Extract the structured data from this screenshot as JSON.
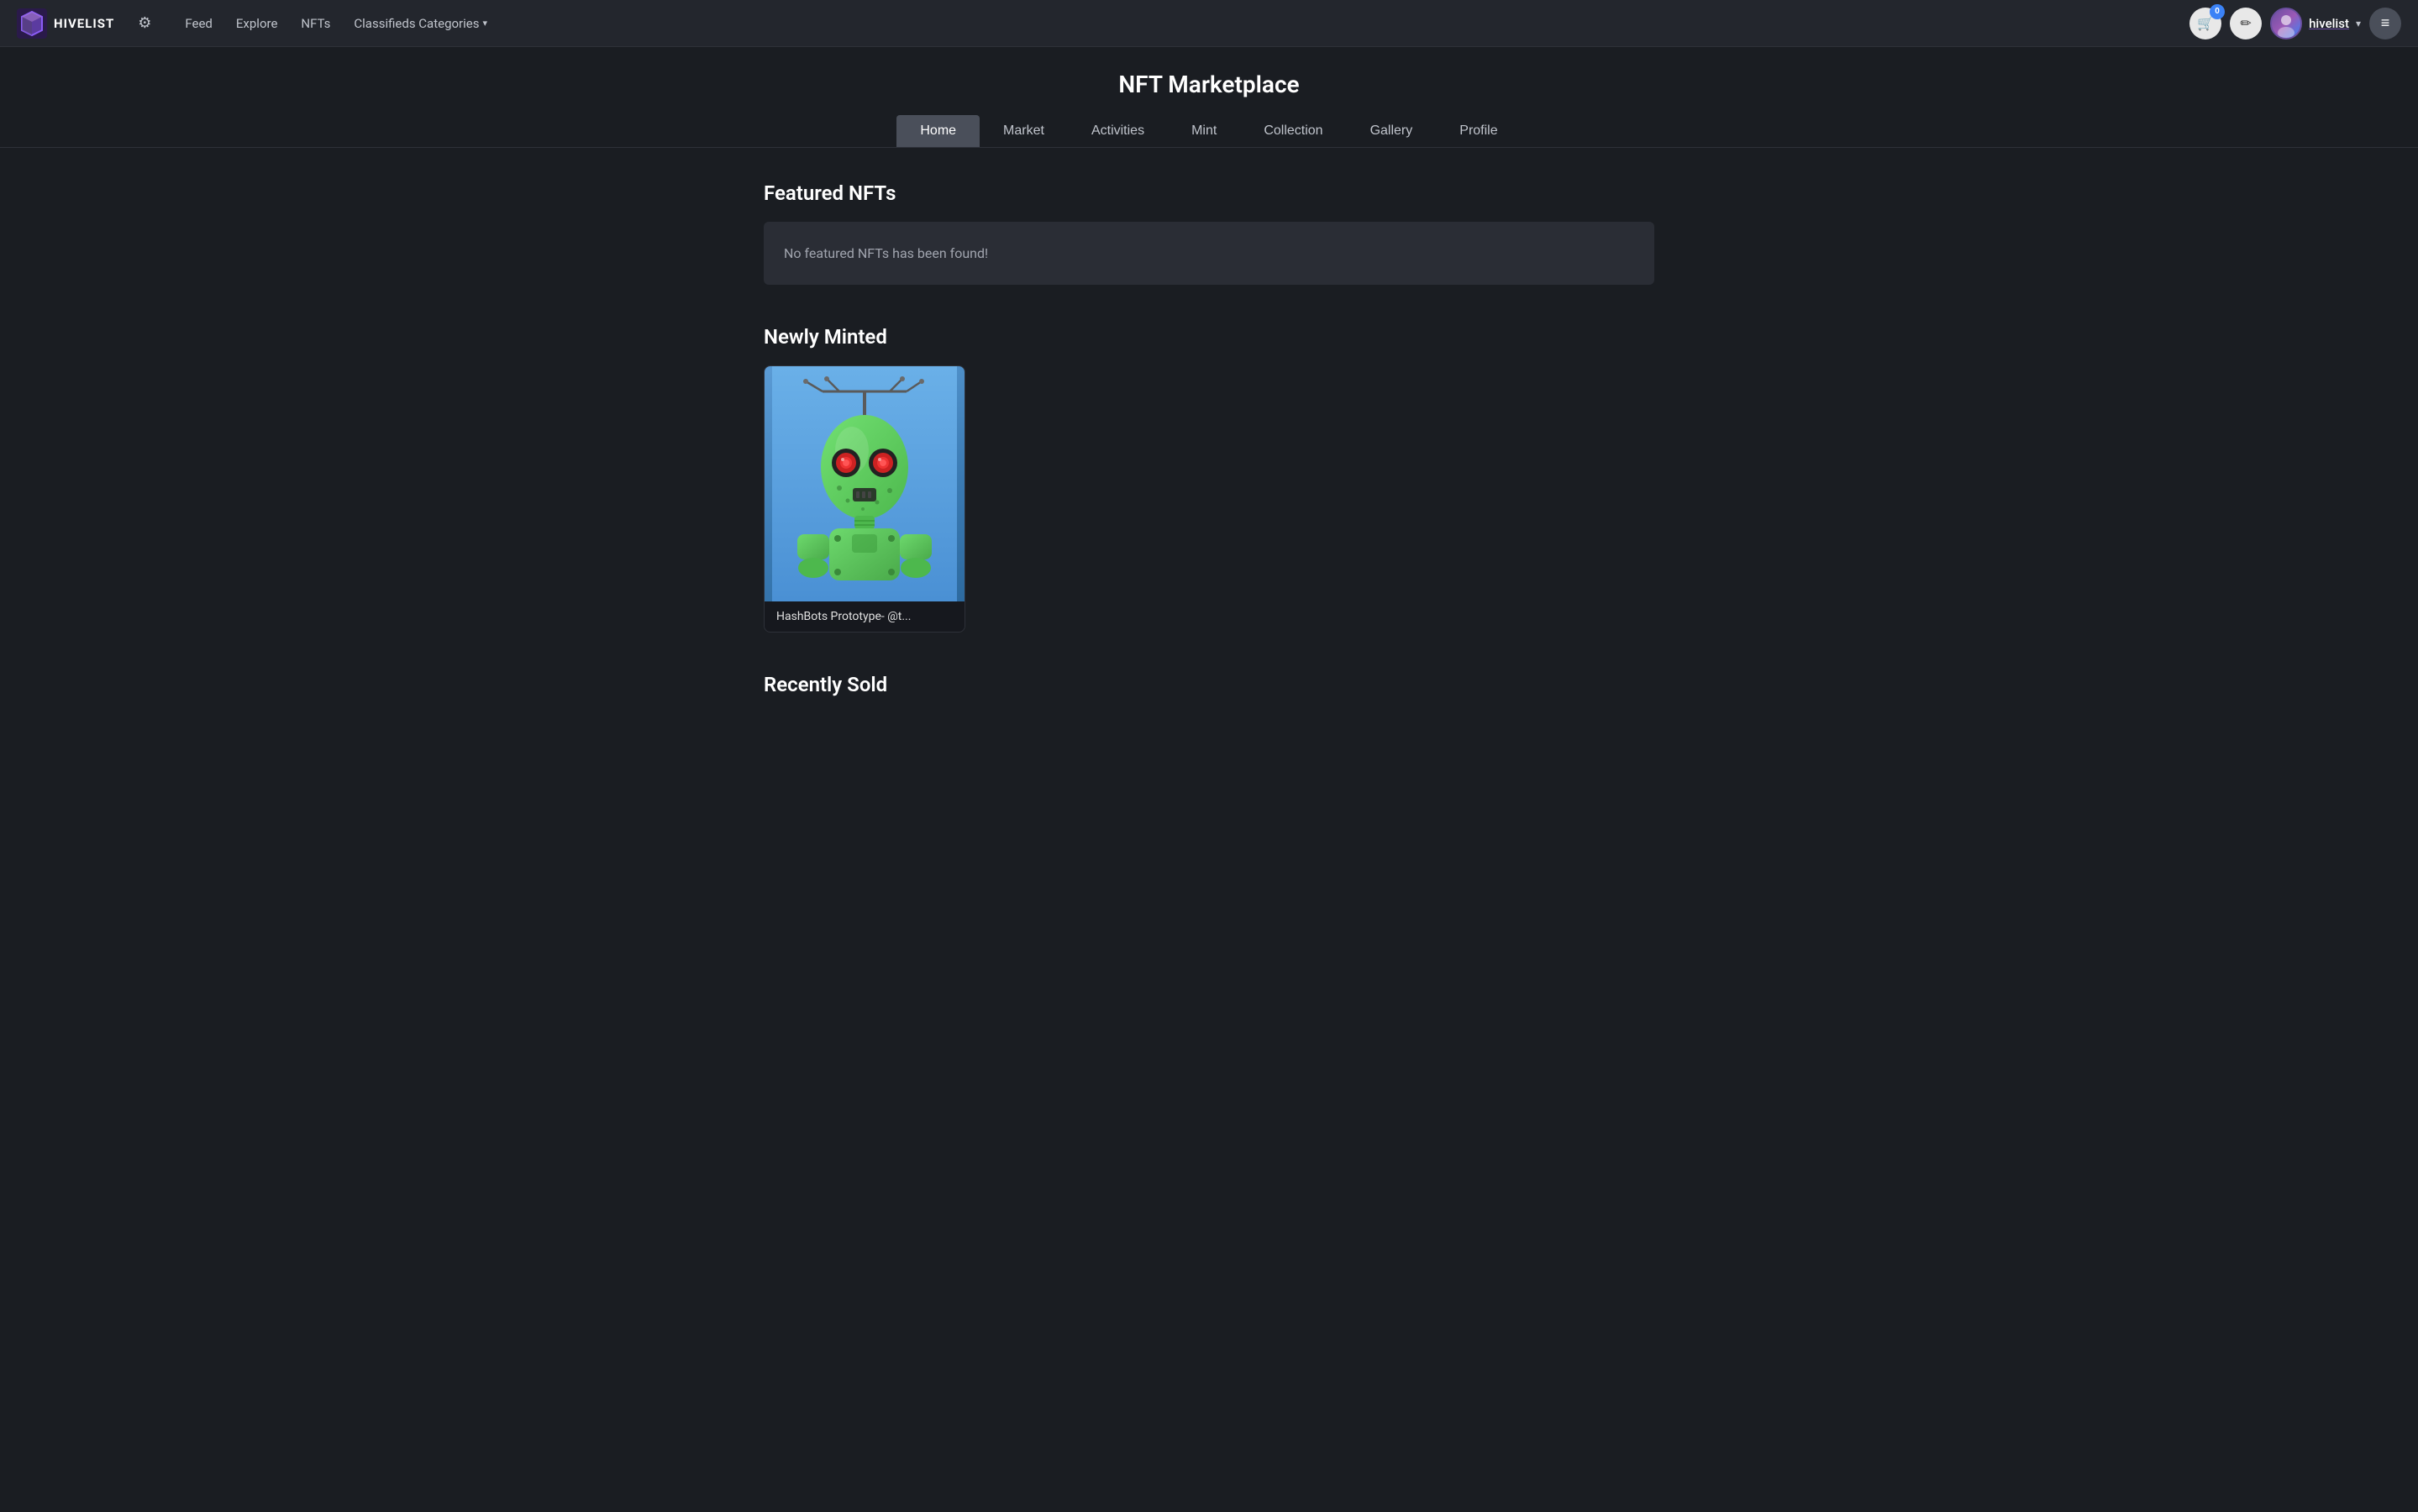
{
  "app": {
    "logo_text": "HIVELIST"
  },
  "navbar": {
    "gear_label": "⚙",
    "feed_label": "Feed",
    "explore_label": "Explore",
    "nfts_label": "NFTs",
    "classifieds_label": "Classifieds Categories",
    "cart_count": "0",
    "pencil_icon": "✏",
    "username": "hivelist",
    "hamburger_icon": "≡"
  },
  "page": {
    "title": "NFT Marketplace"
  },
  "tabs": [
    {
      "label": "Home",
      "active": true
    },
    {
      "label": "Market",
      "active": false
    },
    {
      "label": "Activities",
      "active": false
    },
    {
      "label": "Mint",
      "active": false
    },
    {
      "label": "Collection",
      "active": false
    },
    {
      "label": "Gallery",
      "active": false
    },
    {
      "label": "Profile",
      "active": false
    }
  ],
  "featured": {
    "title": "Featured NFTs",
    "empty_message": "No featured NFTs has been found!"
  },
  "newly_minted": {
    "title": "Newly Minted",
    "items": [
      {
        "name": "HashBots Prototype- @t...",
        "image_alt": "HashBots Prototype Robot NFT"
      }
    ]
  },
  "recently_sold": {
    "title": "Recently Sold"
  }
}
